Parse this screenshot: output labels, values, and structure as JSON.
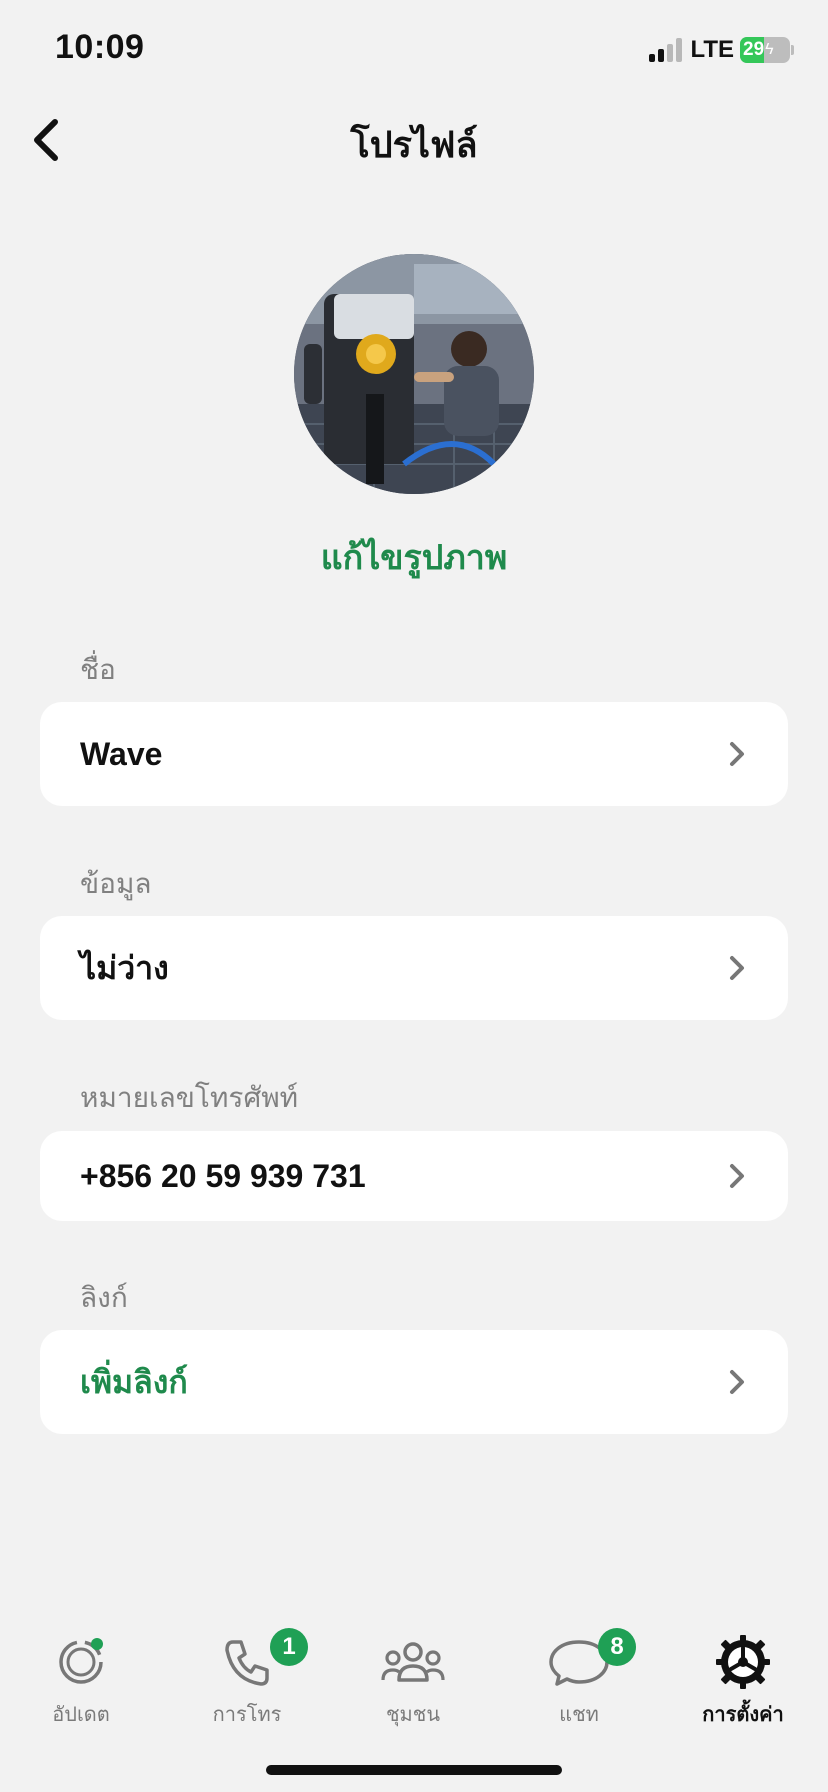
{
  "status_bar": {
    "time": "10:09",
    "network": "LTE",
    "battery": "29"
  },
  "header": {
    "title": "โปรไฟล์"
  },
  "profile": {
    "edit_photo_label": "แก้ไขรูปภาพ",
    "sections": [
      {
        "label": "ชื่อ",
        "value": "Wave"
      },
      {
        "label": "ข้อมูล",
        "value": "ไม่ว่าง"
      },
      {
        "label": "หมายเลขโทรศัพท์",
        "value": "+856 20 59 939 731"
      },
      {
        "label": "ลิงก์",
        "value": "เพิ่มลิงก์"
      }
    ]
  },
  "tabs": [
    {
      "label": "อัปเดต",
      "icon": "updates-icon"
    },
    {
      "label": "การโทร",
      "icon": "phone-icon",
      "badge": "1"
    },
    {
      "label": "ชุมชน",
      "icon": "community-icon"
    },
    {
      "label": "แชท",
      "icon": "chat-icon",
      "badge": "8"
    },
    {
      "label": "การตั้งค่า",
      "icon": "settings-gear-icon",
      "active": true
    }
  ],
  "colors": {
    "accent": "#1f8a4c",
    "badge": "#1fa055",
    "background": "#f2f2f2"
  }
}
